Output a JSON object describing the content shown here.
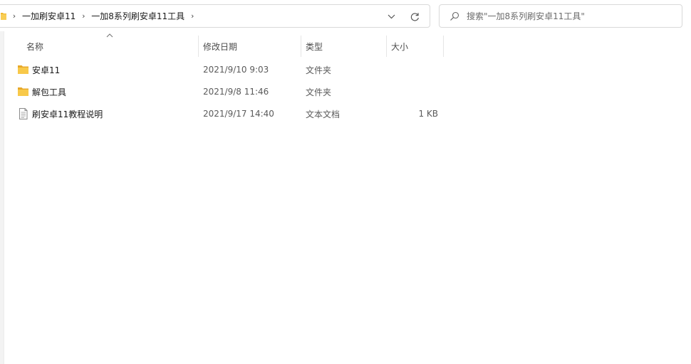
{
  "address_bar": {
    "breadcrumbs": [
      "一加刷安卓11",
      "一加8系列刷安卓11工具"
    ]
  },
  "search": {
    "placeholder": "搜索\"一加8系列刷安卓11工具\""
  },
  "columns": {
    "name": "名称",
    "date": "修改日期",
    "type": "类型",
    "size": "大小"
  },
  "files": [
    {
      "name": "安卓11",
      "date": "2021/9/10 9:03",
      "type": "文件夹",
      "size": "",
      "icon": "folder-icon"
    },
    {
      "name": "解包工具",
      "date": "2021/9/8 11:46",
      "type": "文件夹",
      "size": "",
      "icon": "folder-icon"
    },
    {
      "name": "刷安卓11教程说明",
      "date": "2021/9/17 14:40",
      "type": "文本文档",
      "size": "1 KB",
      "icon": "text-file-icon"
    }
  ],
  "colors": {
    "folder": "#f8c94a",
    "border": "#d9d9d9"
  }
}
